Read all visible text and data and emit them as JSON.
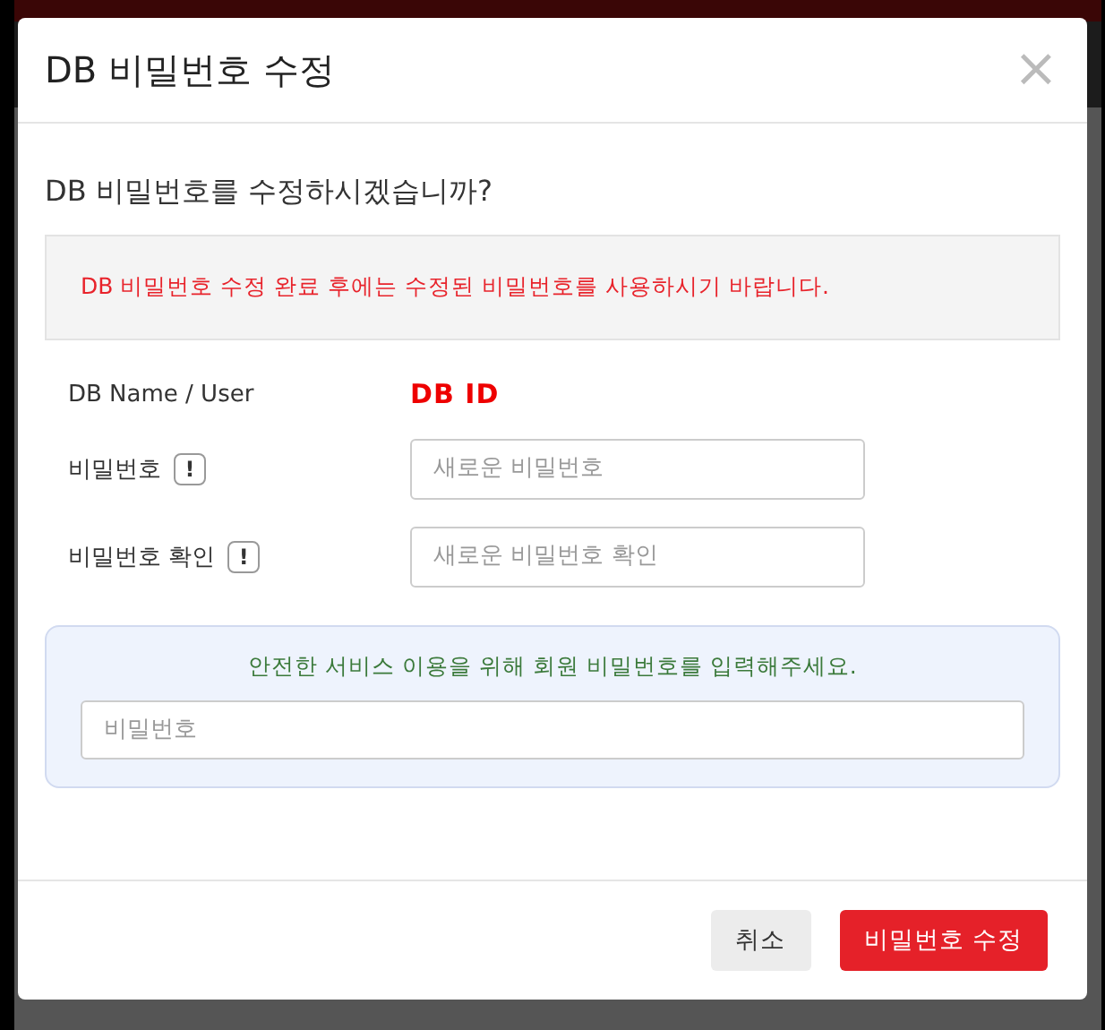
{
  "dialog": {
    "title": "DB 비밀번호 수정",
    "close_label": "×",
    "question": "DB 비밀번호를 수정하시겠습니까?",
    "notice": "DB 비밀번호 수정 완료 후에는 수정된 비밀번호를 사용하시기 바랍니다.",
    "fields": [
      {
        "kind": "value",
        "label": "DB Name / User",
        "value": "DB ID"
      },
      {
        "kind": "input",
        "label": "비밀번호",
        "info": "!",
        "placeholder": "새로운 비밀번호"
      },
      {
        "kind": "input",
        "label": "비밀번호 확인",
        "info": "!",
        "placeholder": "새로운 비밀번호 확인"
      }
    ],
    "verify": {
      "message": "안전한 서비스 이용을 위해 회원 비밀번호를 입력해주세요.",
      "placeholder": "비밀번호"
    },
    "buttons": [
      {
        "kind": "secondary",
        "label": "취소"
      },
      {
        "kind": "primary",
        "label": "비밀번호 수정"
      }
    ]
  }
}
